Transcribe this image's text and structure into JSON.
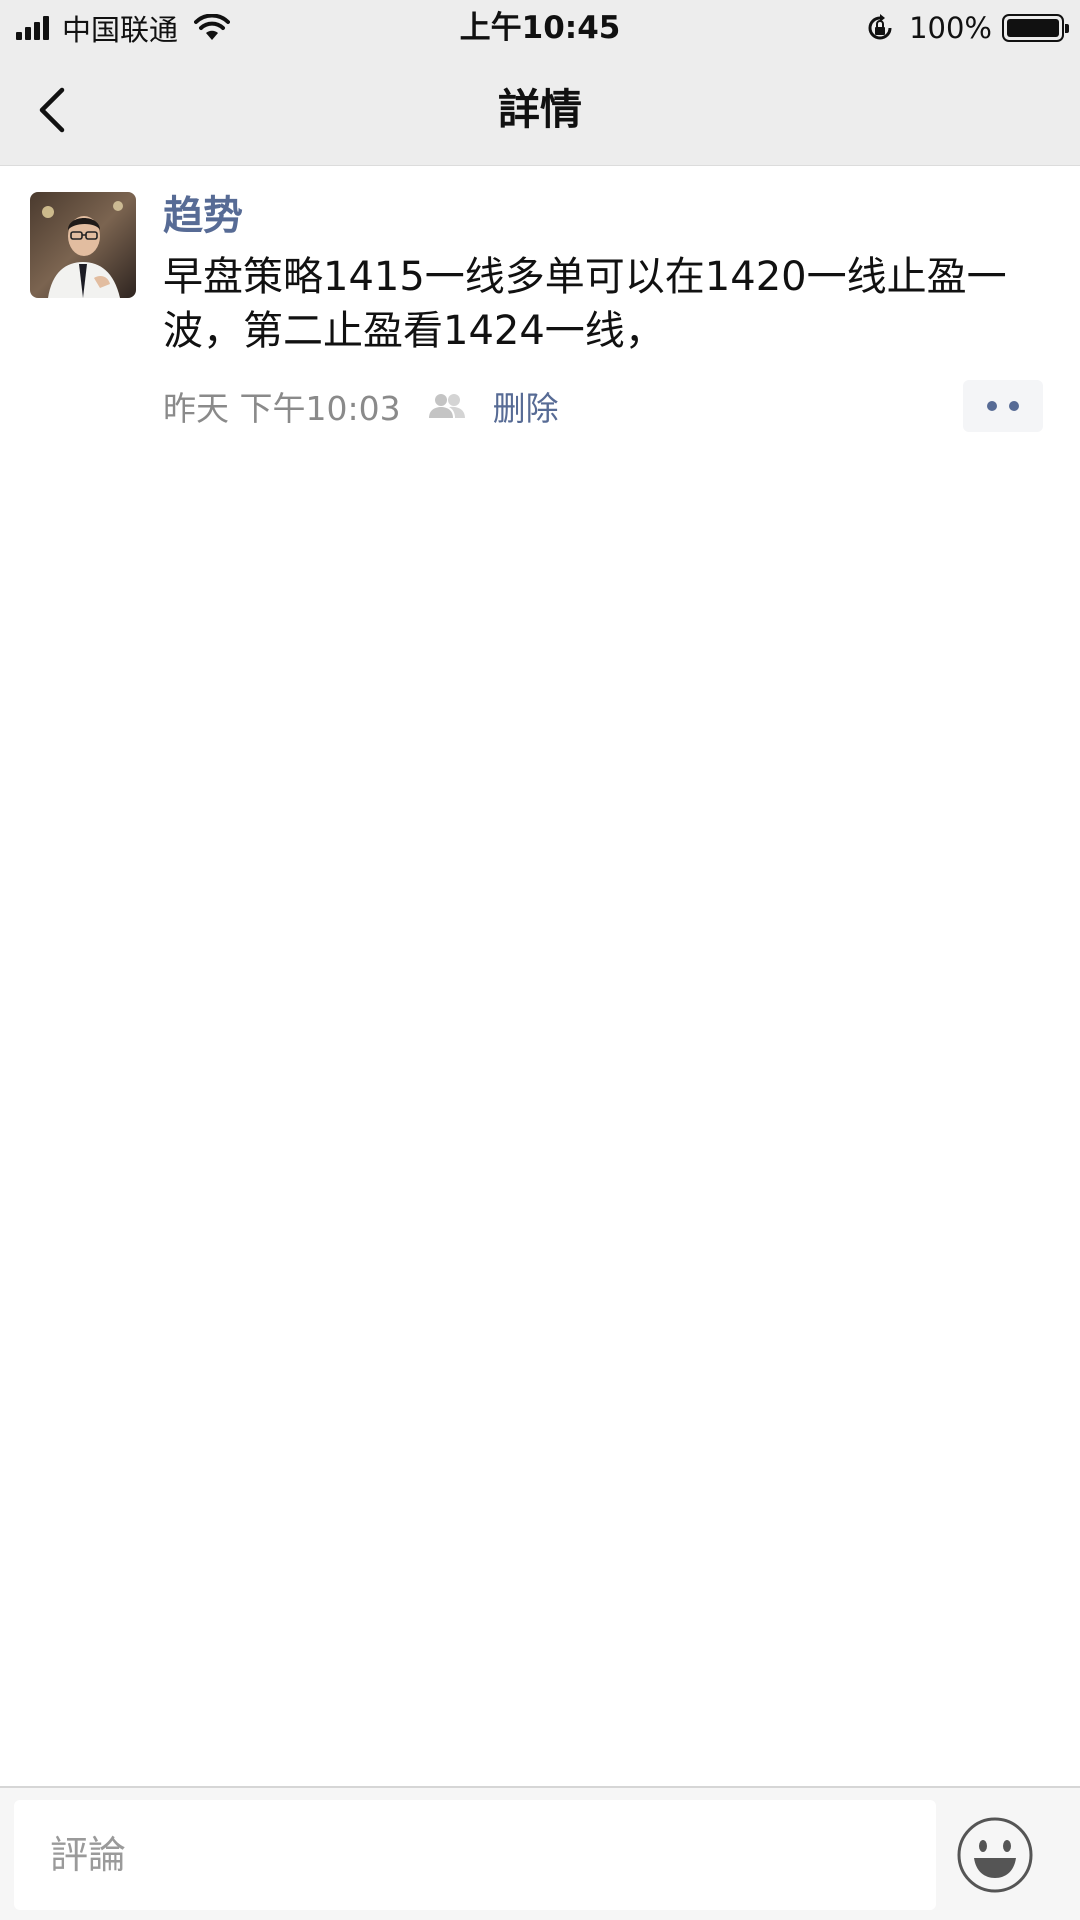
{
  "status_bar": {
    "carrier": "中国联通",
    "time": "上午10:45",
    "battery": "100%",
    "battery_level": 1.0,
    "icons": [
      "signal-icon",
      "wifi-icon",
      "rotation-lock-icon",
      "battery-icon"
    ]
  },
  "nav": {
    "title": "詳情",
    "back_icon": "chevron-left-icon"
  },
  "post": {
    "author": "趋势",
    "content": "早盘策略1415一线多单可以在1420一线止盈一波，第二止盈看1424一线，",
    "time": "昨天 下午10:03",
    "privacy_icon": "people-icon",
    "delete_label": "删除",
    "more_icon": "more-dots-icon"
  },
  "comment": {
    "placeholder": "評論",
    "value": "",
    "emoji_icon": "smiley-emoji-icon"
  },
  "colors": {
    "link": "#576b95",
    "bar_background": "#ededed",
    "meta_text": "#8a8a8a"
  }
}
